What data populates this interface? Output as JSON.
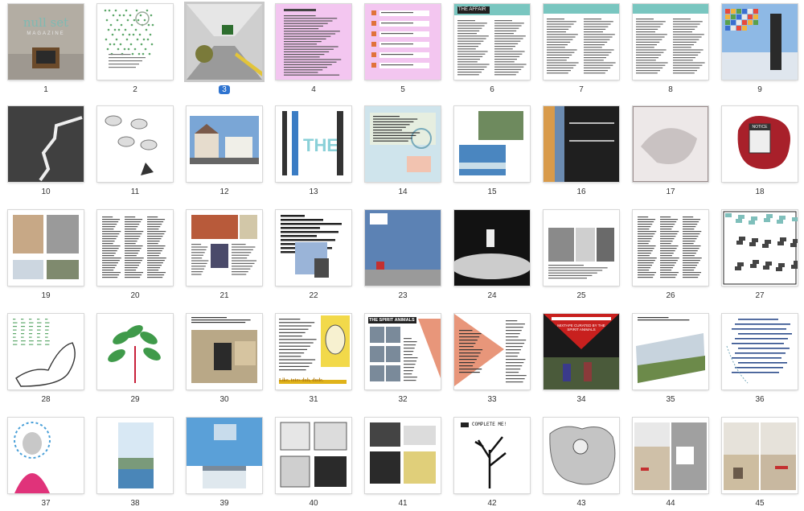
{
  "window": {
    "title": ""
  },
  "selected_page": "3",
  "pages": [
    {
      "number": "1",
      "label": "null set magazine cover",
      "bg": "#b7b1a6",
      "accent": "#7fb9b2",
      "kind": "cover",
      "text": "null set",
      "subtext": "MAGAZINE"
    },
    {
      "number": "2",
      "label": "diagram page",
      "bg": "#ffffff",
      "accent": "#5ea86b",
      "kind": "dots"
    },
    {
      "number": "3",
      "label": "hallway photo",
      "bg": "#c8c8c8",
      "accent": "#2e6e2f",
      "kind": "hall"
    },
    {
      "number": "4",
      "label": "pink text page",
      "bg": "#f3c6f0",
      "accent": "#444444",
      "kind": "text"
    },
    {
      "number": "5",
      "label": "pink list page",
      "bg": "#f3c6f0",
      "accent": "#e0733a",
      "kind": "list"
    },
    {
      "number": "6",
      "label": "the affair page",
      "bg": "#ffffff",
      "accent": "#79c6c0",
      "kind": "affair",
      "text": "THE AFFAIR"
    },
    {
      "number": "7",
      "label": "teal text page",
      "bg": "#ffffff",
      "accent": "#79c6c0",
      "kind": "teal"
    },
    {
      "number": "8",
      "label": "teal text page",
      "bg": "#ffffff",
      "accent": "#79c6c0",
      "kind": "teal"
    },
    {
      "number": "9",
      "label": "sky pixel photo",
      "bg": "#8cb8e6",
      "accent": "#e84a3b",
      "kind": "sky"
    },
    {
      "number": "10",
      "label": "road photo",
      "bg": "#3c3c3c",
      "accent": "#e8e8e8",
      "kind": "road"
    },
    {
      "number": "11",
      "label": "cloud sketch",
      "bg": "#ffffff",
      "accent": "#666666",
      "kind": "clouds"
    },
    {
      "number": "12",
      "label": "house collage",
      "bg": "#ffffff",
      "accent": "#5c88b8",
      "kind": "houses"
    },
    {
      "number": "13",
      "label": "typography poster",
      "bg": "#ffffff",
      "accent": "#3a7cc4",
      "kind": "type",
      "text": "THE"
    },
    {
      "number": "14",
      "label": "collage text",
      "bg": "#cfe4ec",
      "accent": "#e07a5f",
      "kind": "collage"
    },
    {
      "number": "15",
      "label": "film photos",
      "bg": "#ffffff",
      "accent": "#6aa0c8",
      "kind": "film"
    },
    {
      "number": "16",
      "label": "gradient photo",
      "bg": "#1f1f1f",
      "accent": "#d98a3a",
      "kind": "gradient"
    },
    {
      "number": "17",
      "label": "grey sketch",
      "bg": "#ebe6e6",
      "accent": "#9a8c8c",
      "kind": "grey"
    },
    {
      "number": "18",
      "label": "notice splat",
      "bg": "#ffffff",
      "accent": "#a8202a",
      "kind": "splat",
      "text": "NOTICE"
    },
    {
      "number": "19",
      "label": "photo grid",
      "bg": "#ffffff",
      "accent": "#9a8266",
      "kind": "photogrid"
    },
    {
      "number": "20",
      "label": "text columns",
      "bg": "#ffffff",
      "accent": "#555555",
      "kind": "columns"
    },
    {
      "number": "21",
      "label": "collage photos",
      "bg": "#ffffff",
      "accent": "#c44a3a",
      "kind": "collage2"
    },
    {
      "number": "22",
      "label": "redacted text",
      "bg": "#ffffff",
      "accent": "#222222",
      "kind": "redacted"
    },
    {
      "number": "23",
      "label": "blue wall",
      "bg": "#5a7fb0",
      "accent": "#c43030",
      "kind": "wall"
    },
    {
      "number": "24",
      "label": "skate photo",
      "bg": "#111111",
      "accent": "#dddddd",
      "kind": "skate"
    },
    {
      "number": "25",
      "label": "bw photos",
      "bg": "#ffffff",
      "accent": "#777777",
      "kind": "bw"
    },
    {
      "number": "26",
      "label": "text page",
      "bg": "#ffffff",
      "accent": "#555555",
      "kind": "columns"
    },
    {
      "number": "27",
      "label": "comic drawing",
      "bg": "#ffffff",
      "accent": "#7fbfbb",
      "kind": "comic"
    },
    {
      "number": "28",
      "label": "figure drawing",
      "bg": "#ffffff",
      "accent": "#5ea86b",
      "kind": "figure"
    },
    {
      "number": "29",
      "label": "plant drawing",
      "bg": "#ffffff",
      "accent": "#3f9a4a",
      "kind": "plant"
    },
    {
      "number": "30",
      "label": "barrel photo",
      "bg": "#ffffff",
      "accent": "#7a6a4e",
      "kind": "barrel"
    },
    {
      "number": "31",
      "label": "yellow quote",
      "bg": "#ffffff",
      "accent": "#e0b31a",
      "kind": "quote",
      "text": "Like, totes duh, dude."
    },
    {
      "number": "32",
      "label": "the spirit animals",
      "bg": "#ffffff",
      "accent": "#e8967a",
      "kind": "spirit",
      "text": "THE SPIRIT ANIMALS"
    },
    {
      "number": "33",
      "label": "salmon triangle",
      "bg": "#ffffff",
      "accent": "#e8967a",
      "kind": "triangle"
    },
    {
      "number": "34",
      "label": "mixtape page",
      "bg": "#1a1a1a",
      "accent": "#c8201e",
      "kind": "mixtape",
      "text": "MIXTAPE CURATED BY THE SPIRIT ANIMALS"
    },
    {
      "number": "35",
      "label": "field photo",
      "bg": "#ffffff",
      "accent": "#6c8a4a",
      "kind": "field"
    },
    {
      "number": "36",
      "label": "handwriting",
      "bg": "#ffffff",
      "accent": "#2a4a8a",
      "kind": "hand"
    },
    {
      "number": "37",
      "label": "pink feathers",
      "bg": "#ffffff",
      "accent": "#e0337a",
      "kind": "feathers"
    },
    {
      "number": "38",
      "label": "harbor photo",
      "bg": "#ffffff",
      "accent": "#4a86b8",
      "kind": "harbor"
    },
    {
      "number": "39",
      "label": "blue collage",
      "bg": "#ffffff",
      "accent": "#3a8ac8",
      "kind": "blue"
    },
    {
      "number": "40",
      "label": "bw sketches",
      "bg": "#ffffff",
      "accent": "#444444",
      "kind": "sketch"
    },
    {
      "number": "41",
      "label": "bw collage",
      "bg": "#ffffff",
      "accent": "#b09a3a",
      "kind": "bwcollage"
    },
    {
      "number": "42",
      "label": "complete me",
      "bg": "#ffffff",
      "accent": "#111111",
      "kind": "tree",
      "text": "COMPLETE ME!"
    },
    {
      "number": "43",
      "label": "grey map",
      "bg": "#ffffff",
      "accent": "#888888",
      "kind": "map"
    },
    {
      "number": "44",
      "label": "outdoor photos",
      "bg": "#ffffff",
      "accent": "#c43030",
      "kind": "outdoor"
    },
    {
      "number": "45",
      "label": "outdoor photos",
      "bg": "#ffffff",
      "accent": "#c43030",
      "kind": "outdoor2"
    }
  ]
}
